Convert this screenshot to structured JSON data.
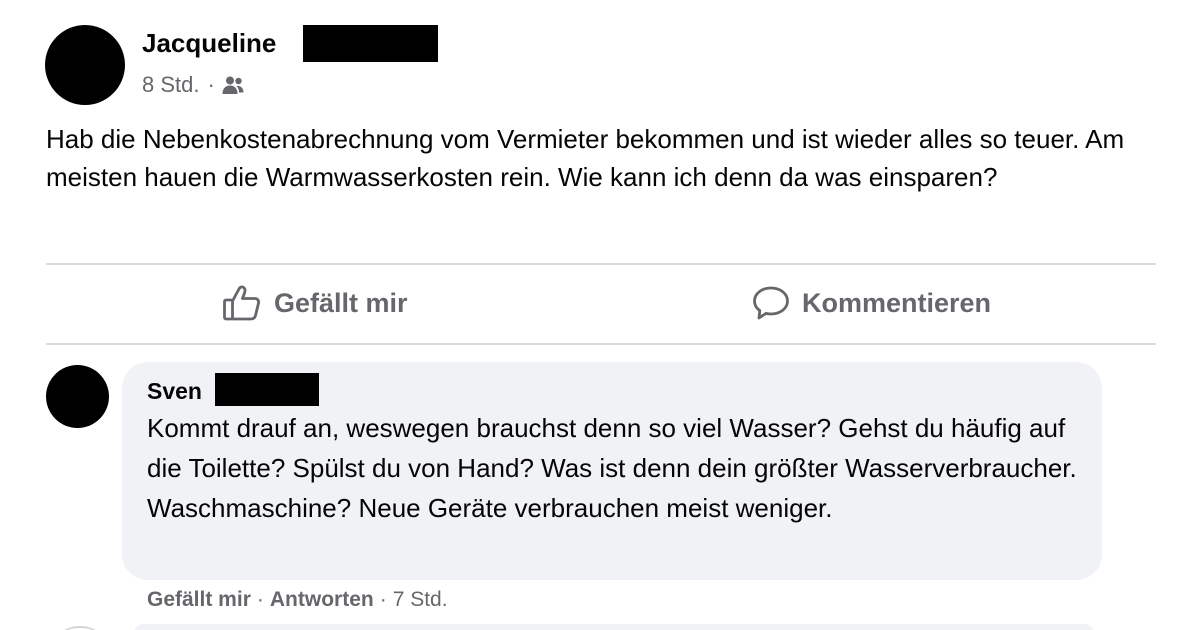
{
  "post": {
    "author_name": "Jacqueline",
    "time": "8 Std.",
    "separator": "·",
    "audience_icon": "friends-icon",
    "text": "Hab die Nebenkostenabrechnung vom Vermieter bekommen und ist wieder alles so teuer. Am meisten hauen die Warmwasserkosten rein. Wie kann ich denn da was einsparen?"
  },
  "actions": {
    "like_label": "Gefällt mir",
    "like_icon": "thumbs-up-icon",
    "comment_label": "Kommentieren",
    "comment_icon": "speech-bubble-icon"
  },
  "comment": {
    "author_name": "Sven",
    "text": "Kommt drauf an, weswegen brauchst denn so viel Wasser? Gehst du häufig auf die Toilette? Spülst du von Hand? Was ist denn dein größter Wasserverbraucher. Waschmaschine? Neue Geräte verbrauchen meist weniger.",
    "like_label": "Gefällt mir",
    "reply_label": "Antworten",
    "separator": "·",
    "time": "7 Std."
  },
  "colors": {
    "text_primary": "#050505",
    "text_secondary": "#65676b",
    "bubble_bg": "#f0f2f5",
    "divider": "#d8dadf",
    "redaction": "#000000"
  }
}
